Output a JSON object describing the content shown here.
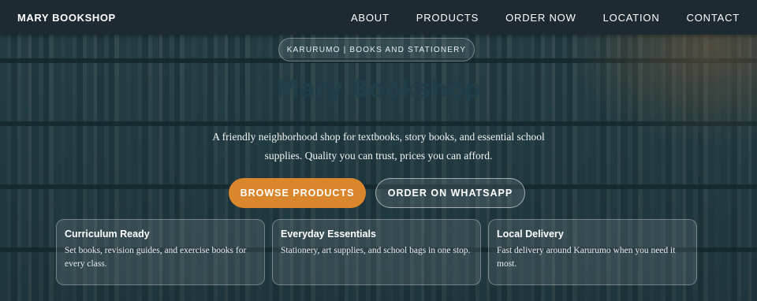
{
  "nav": {
    "brand": "MARY BOOKSHOP",
    "links": [
      "ABOUT",
      "PRODUCTS",
      "ORDER NOW",
      "LOCATION",
      "CONTACT"
    ]
  },
  "hero": {
    "tagline": "KARURUMO | BOOKS AND STATIONERY",
    "title": "Mary Bookshop",
    "description": "A friendly neighborhood shop for textbooks, story books, and essential school supplies. Quality you can trust, prices you can afford.",
    "primary_button": "BROWSE PRODUCTS",
    "secondary_button": "ORDER ON WHATSAPP"
  },
  "features": [
    {
      "title": "Curriculum Ready",
      "text": "Set books, revision guides, and exercise books for every class."
    },
    {
      "title": "Everyday Essentials",
      "text": "Stationery, art supplies, and school bags in one stop."
    },
    {
      "title": "Local Delivery",
      "text": "Fast delivery around Karurumo when you need it most."
    }
  ],
  "colors": {
    "nav_bg": "#1e2a31",
    "accent": "#d9862c",
    "title": "#213f4a"
  }
}
